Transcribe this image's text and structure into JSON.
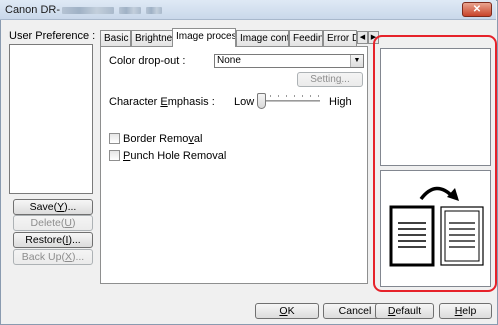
{
  "window": {
    "title": "Canon DR-",
    "close_glyph": "✕"
  },
  "sidebar": {
    "label": "User Preference :",
    "buttons": [
      {
        "pre": "Save(",
        "key": "Y",
        "post": ")...",
        "enabled": true
      },
      {
        "pre": "Delete(",
        "key": "U",
        "post": ")",
        "enabled": false
      },
      {
        "pre": "Restore(",
        "key": "I",
        "post": ")...",
        "enabled": true
      },
      {
        "pre": "Back Up(",
        "key": "X",
        "post": ")...",
        "enabled": false
      }
    ]
  },
  "tabs": [
    {
      "label": "Basic"
    },
    {
      "label": "Brightness"
    },
    {
      "label": "Image processing",
      "active": true
    },
    {
      "label": "Image control"
    },
    {
      "label": "Feeding"
    },
    {
      "label": "Error De"
    }
  ],
  "tab_scroll": {
    "left": "◀",
    "right": "▶"
  },
  "image_processing": {
    "color_dropout": {
      "label_pre": "Color drop-out :",
      "value": "None"
    },
    "setting_button": {
      "pre": "Settin",
      "key": "g",
      "post": "..."
    },
    "character_emphasis": {
      "label_pre": "Character ",
      "key": "E",
      "label_post": "mphasis :",
      "low": "Low",
      "high": "High",
      "level": 0
    },
    "border_removal": {
      "pre": "Border Remo",
      "key": "v",
      "post": "al",
      "checked": false
    },
    "punch_hole_removal": {
      "pre": "",
      "key": "P",
      "post": "unch Hole Removal",
      "checked": false
    }
  },
  "footer": {
    "ok": {
      "pre": "",
      "key": "O",
      "post": "K"
    },
    "cancel": {
      "label": "Cancel"
    },
    "default": {
      "pre": "",
      "key": "D",
      "post": "efault"
    },
    "help": {
      "pre": "",
      "key": "H",
      "post": "elp"
    }
  },
  "colors": {
    "highlight_box": "#e6222a"
  },
  "icons": {
    "rotate": "curved-arrow-icon"
  }
}
